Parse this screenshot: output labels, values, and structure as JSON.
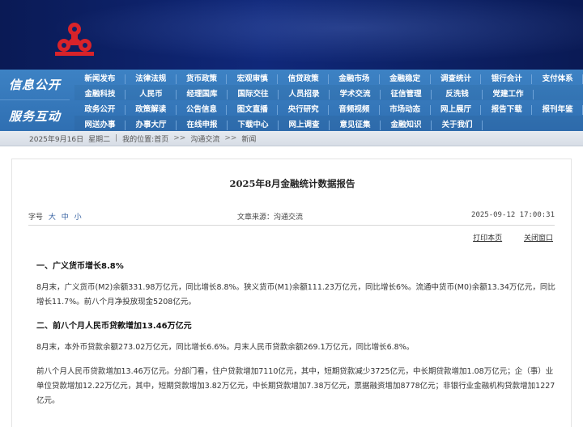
{
  "nav": {
    "label_1": "信息公开",
    "label_2": "服务互动",
    "rows": [
      [
        "新闻发布",
        "法律法规",
        "货币政策",
        "宏观审慎",
        "信贷政策",
        "金融市场",
        "金融稳定",
        "调查统计",
        "银行会计",
        "支付体系"
      ],
      [
        "金融科技",
        "人民币",
        "经理国库",
        "国际交往",
        "人员招录",
        "学术交流",
        "征信管理",
        "反洗钱",
        "党建工作",
        ""
      ],
      [
        "政务公开",
        "政策解读",
        "公告信息",
        "图文直播",
        "央行研究",
        "音频视频",
        "市场动态",
        "网上展厅",
        "报告下载",
        "报刊年鉴"
      ],
      [
        "网送办事",
        "办事大厅",
        "在线申报",
        "下载中心",
        "网上调查",
        "意见征集",
        "金融知识",
        "关于我们",
        "",
        ""
      ]
    ]
  },
  "breadcrumb": {
    "date": "2025年9月16日",
    "weekday": "星期二",
    "location_prefix": "我的位置:",
    "home": "首页",
    "section": "沟通交流",
    "current": "新闻"
  },
  "article": {
    "title": "2025年8月金融统计数据报告",
    "font_size_label": "字号",
    "font_sizes": [
      "大",
      "中",
      "小"
    ],
    "source": "文章来源：沟通交流",
    "date": "2025-09-12 17:00:31",
    "print_link": "打印本页",
    "close_link": "关闭窗口",
    "sections": [
      {
        "heading": "一、广义货币增长8.8%",
        "paragraphs": [
          "8月末，广义货币(M2)余额331.98万亿元，同比增长8.8%。狭义货币(M1)余额111.23万亿元，同比增长6%。流通中货币(M0)余额13.34万亿元，同比增长11.7%。前八个月净投放现金5208亿元。"
        ]
      },
      {
        "heading": "二、前八个月人民币贷款增加13.46万亿元",
        "paragraphs": [
          "8月末，本外币贷款余额273.02万亿元，同比增长6.6%。月末人民币贷款余额269.1万亿元，同比增长6.8%。",
          "前八个月人民币贷款增加13.46万亿元。分部门看，住户贷款增加7110亿元，其中，短期贷款减少3725亿元，中长期贷款增加1.08万亿元；企（事）业单位贷款增加12.22万亿元，其中，短期贷款增加3.82万亿元，中长期贷款增加7.38万亿元，票据融资增加8778亿元；非银行业金融机构贷款增加1227亿元。"
        ]
      }
    ]
  }
}
